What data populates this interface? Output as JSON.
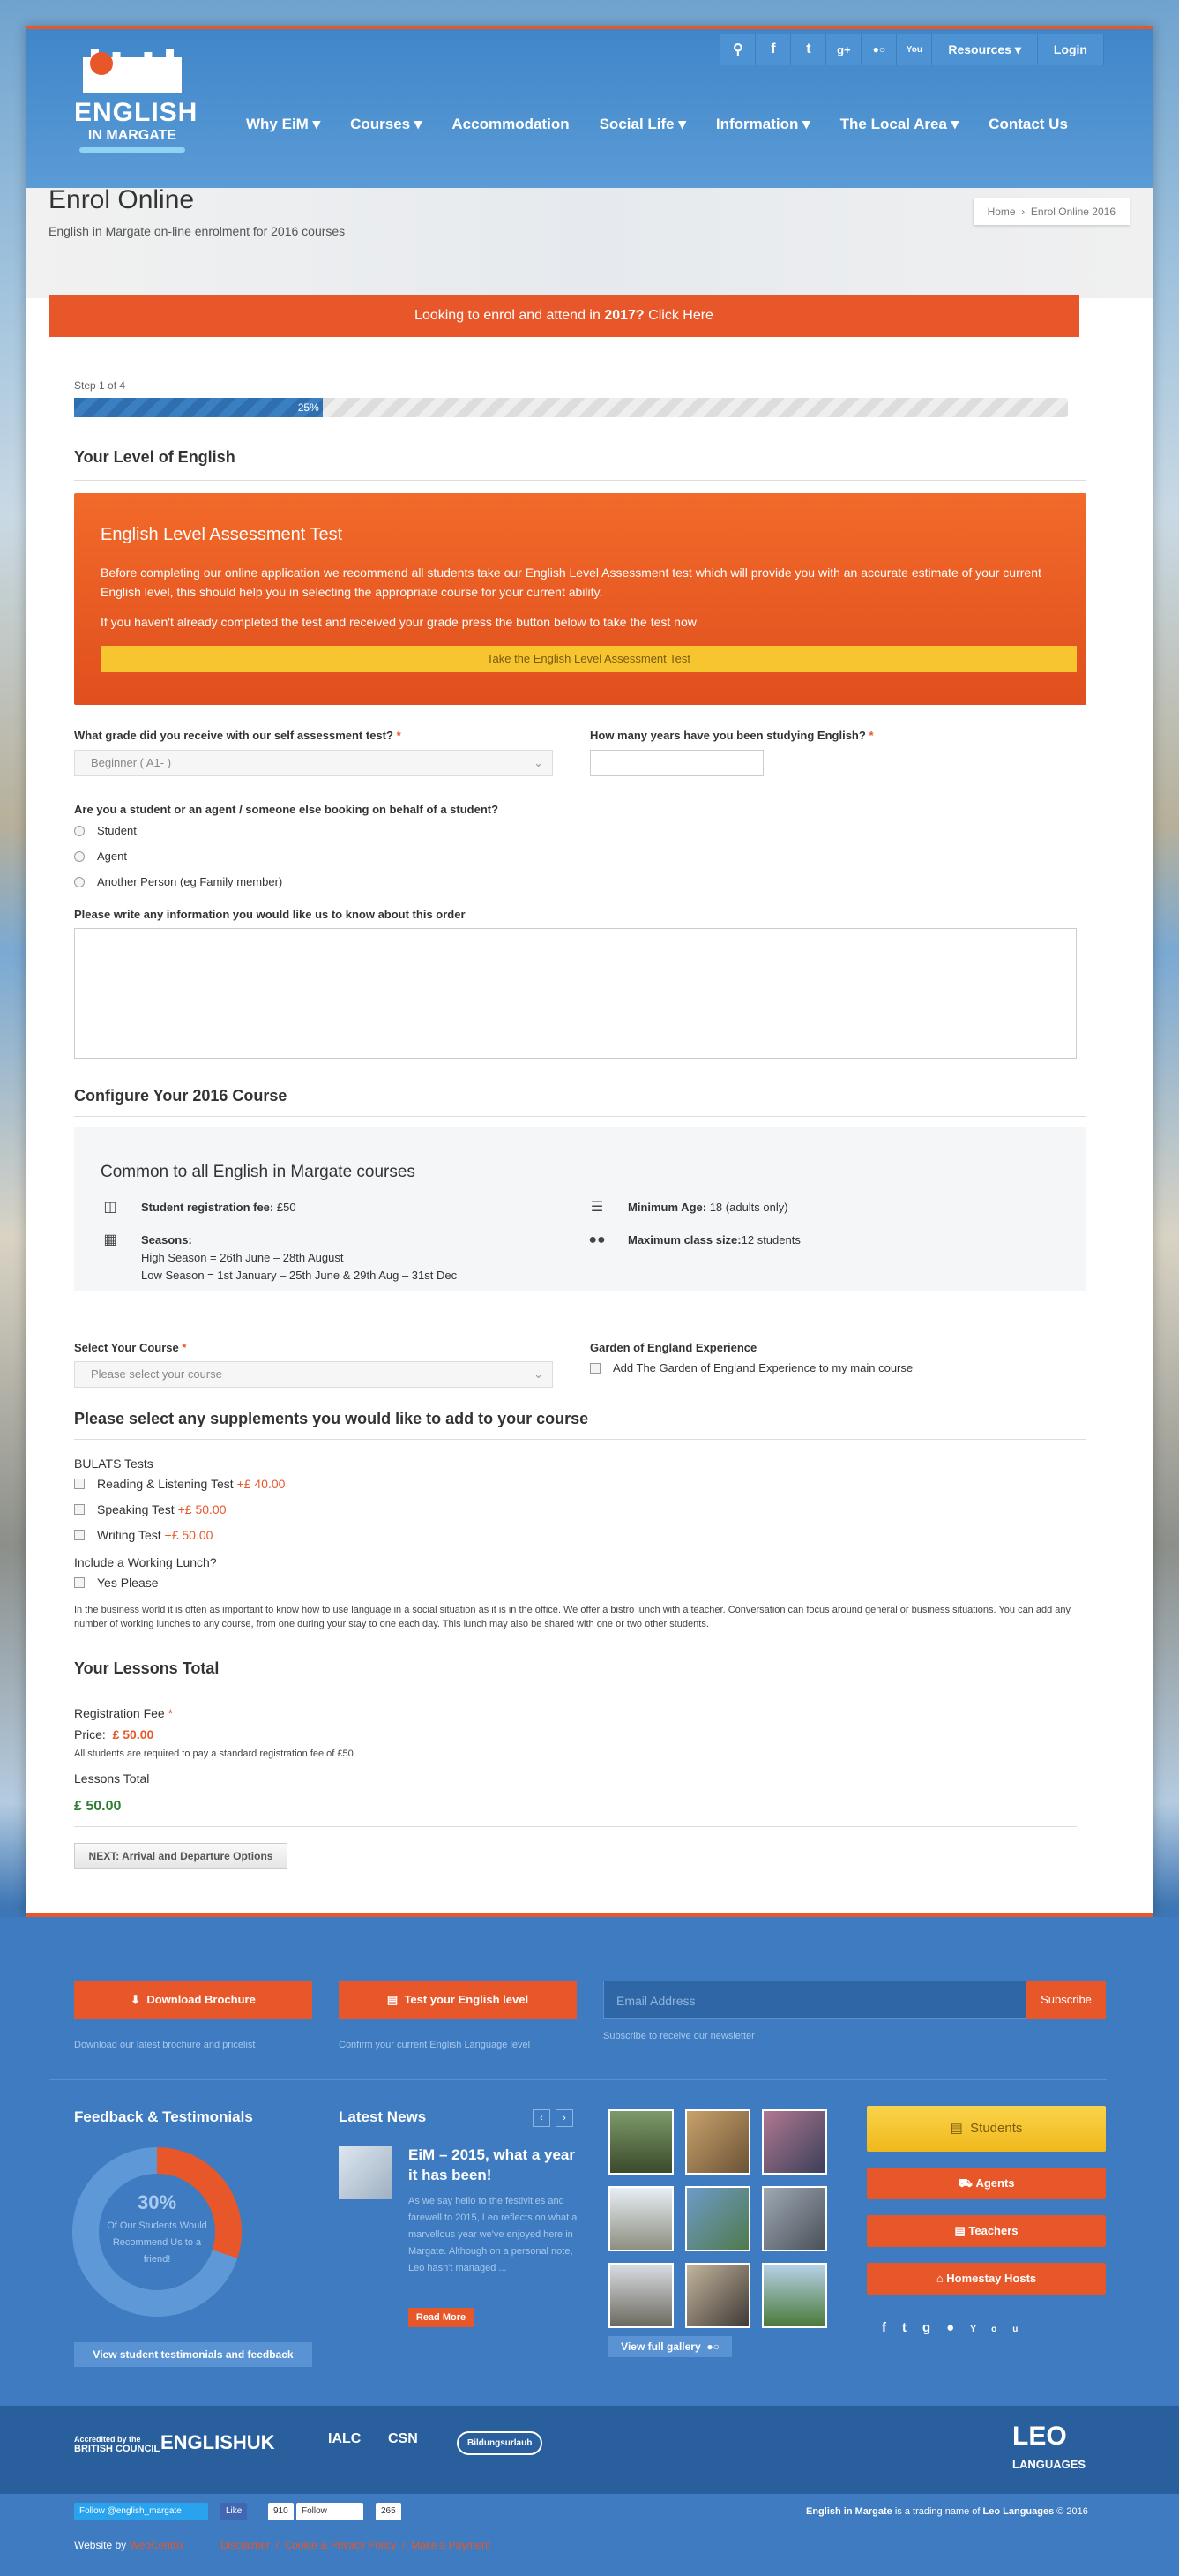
{
  "topbar": {
    "search_icon": "search-icon",
    "resources": "Resources",
    "login": "Login",
    "social": [
      "facebook-icon",
      "twitter-icon",
      "googleplus-icon",
      "flickr-icon",
      "youtube-icon"
    ]
  },
  "logo": {
    "line1": "ENGLISH",
    "line2": "IN MARGATE"
  },
  "nav": [
    "Why EiM",
    "Courses",
    "Accommodation",
    "Social Life",
    "Information",
    "The Local Area",
    "Contact Us"
  ],
  "page": {
    "title": "Enrol Online",
    "subtitle": "English in Margate on-line enrolment for 2016 courses",
    "breadcrumb_home": "Home",
    "breadcrumb_current": "Enrol Online 2016"
  },
  "banner": {
    "prefix": "Looking to enrol and attend in ",
    "year": "2017?",
    "suffix": " Click Here"
  },
  "step": {
    "label": "Step 1 of 4",
    "progress_label": "25%",
    "progress": 0.25
  },
  "level": {
    "heading": "Your Level of English",
    "box_title": "English Level Assessment Test",
    "box_p1": "Before completing our online application we recommend all students take our English Level Assessment test which will provide you with an accurate estimate of your current English level, this should help you in selecting the appropriate course for your current ability.",
    "box_p2": "If you haven't already completed the test and received your grade press the button below to take the test now",
    "box_button": "Take the English Level Assessment Test"
  },
  "form": {
    "grade_label": "What grade did you receive with our self assessment test?",
    "grade_value": "Beginner ( A1- )",
    "years_label": "How many years have you been studying English?",
    "who_label": "Are you a student or an agent / someone else booking on behalf of a student?",
    "who_options": [
      "Student",
      "Agent",
      "Another Person (eg Family member)"
    ],
    "info_label": "Please write any information you would like us to know about this order"
  },
  "configure": {
    "heading": "Configure Your 2016 Course",
    "common_title": "Common to all English in Margate courses",
    "reg_fee_label": "Student registration fee:",
    "reg_fee": "£50",
    "seasons_label": "Seasons:",
    "high_season": "High Season = 26th June – 28th August",
    "low_season": "Low Season = 1st January – 25th June & 29th Aug – 31st Dec",
    "min_age_label": "Minimum Age:",
    "min_age": "18 (adults only)",
    "class_size_label": "Maximum class size:",
    "class_size": "12 students",
    "select_course_label": "Select Your Course",
    "select_course_placeholder": "Please select your course",
    "garden_label": "Garden of England Experience",
    "garden_option": "Add The Garden of England Experience to my main course"
  },
  "supplements": {
    "heading": "Please select any supplements you would like to add to your course",
    "bulats_label": "BULATS Tests",
    "items": [
      {
        "label": "Reading & Listening Test ",
        "price": "+£ 40.00"
      },
      {
        "label": "Speaking Test ",
        "price": "+£ 50.00"
      },
      {
        "label": "Writing Test ",
        "price": "+£ 50.00"
      }
    ],
    "lunch_label": "Include a Working Lunch?",
    "lunch_option": "Yes Please",
    "lunch_note": "In the business world it is often as important to know how to use language in a social situation as it is in the office. We offer a bistro lunch with a teacher. Conversation can focus around general or business situations. You can add any number of working lunches to any course, from one during your stay to one each day. This lunch may also be shared with one or two other students."
  },
  "total": {
    "heading": "Your Lessons Total",
    "reg_label": "Registration Fee",
    "price_label": "Price:",
    "price": "£ 50.00",
    "note": "All students are required to pay a standard registration fee of £50",
    "lessons_label": "Lessons Total",
    "amount": "£ 50.00",
    "next": "NEXT: Arrival and Departure Options"
  },
  "footer": {
    "brochure": "Download Brochure",
    "brochure_note": "Download our latest brochure and pricelist",
    "test": "Test your English level",
    "test_note": "Confirm your current English Language level",
    "email_placeholder": "Email Address",
    "subscribe": "Subscribe",
    "subscribe_note": "Subscribe to receive our newsletter",
    "feedback_title": "Feedback & Testimonials",
    "feedback_pct": "30%",
    "feedback_text": "Of Our Students Would Recommend Us to a friend!",
    "feedback_value": 0.3,
    "feedback_btn": "View student testimonials and feedback",
    "news_title": "Latest News",
    "news_headline": "EiM – 2015, what a year it has been!",
    "news_text": "As we say hello to the festivities and farewell to 2015, Leo reflects on what a marvellous year we've enjoyed here in Margate. Although on a personal note, Leo hasn't managed ...",
    "read_more": "Read More",
    "gallery_btn": "View full gallery",
    "students": "Students",
    "agents": "Agents",
    "teachers": "Teachers",
    "homestay": "Homestay Hosts",
    "accreditations": [
      "BRITISH COUNCIL",
      "ENGLISHUK",
      "IALC",
      "CSN",
      "Bildungsurlaub"
    ],
    "accredited_by": "Accredited by the",
    "leo": "LEO",
    "leo_sub": "LANGUAGES",
    "follow": "Follow @english_margate",
    "like": "Like",
    "like_count": "910",
    "gfollow": "Follow",
    "gcount": "265",
    "trading_pre": "English in Margate",
    "trading_mid": " is a trading name of ",
    "trading_leo": "Leo Languages",
    "trading_year": " © 2016",
    "website_by": "Website by ",
    "webcentrix": "WebCentrix",
    "links": [
      "Disclaimer",
      "Cookie & Privacy Policy",
      "Make a Payment"
    ]
  },
  "colors": {
    "accent": "#e8572a",
    "brand_blue": "#3e7bc0",
    "yellow": "#f7c52f"
  }
}
